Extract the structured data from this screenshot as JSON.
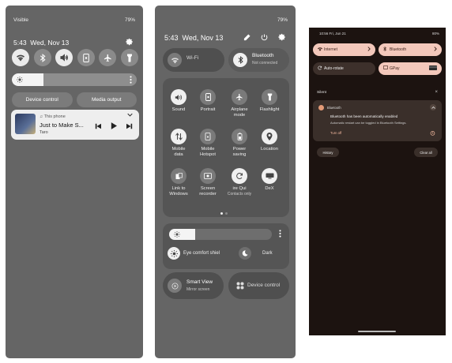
{
  "panel_a": {
    "status": {
      "left": "Visible",
      "right": "79%"
    },
    "clock": {
      "time": "5:43",
      "date": "Wed, Nov 13"
    },
    "toggles": [
      {
        "name": "wifi",
        "icon": "wifi-icon",
        "on": true
      },
      {
        "name": "bluetooth",
        "icon": "bluetooth-icon",
        "on": false
      },
      {
        "name": "sound",
        "icon": "sound-icon",
        "on": true
      },
      {
        "name": "portrait",
        "icon": "portrait-lock-icon",
        "on": false
      },
      {
        "name": "airplane",
        "icon": "airplane-icon",
        "on": false
      },
      {
        "name": "flashlight",
        "icon": "flashlight-icon",
        "on": false
      }
    ],
    "brightness": 0.25,
    "buttons": {
      "device_control": "Device control",
      "media_output": "Media output"
    },
    "media": {
      "source": "This phone",
      "title": "Just to Make S...",
      "artist": "Taro"
    }
  },
  "panel_b": {
    "status": {
      "right": "79%"
    },
    "clock": {
      "time": "5:43",
      "date": "Wed, Nov 13"
    },
    "wifi_tile": {
      "label": "Wi-Fi"
    },
    "bluetooth_tile": {
      "label": "Bluetooth",
      "sub": "Not connected"
    },
    "grid": [
      {
        "label": "Sound",
        "icon": "sound-icon",
        "on": true
      },
      {
        "label": "Portrait",
        "icon": "portrait-lock-icon",
        "on": false
      },
      {
        "label": "Airplane",
        "label2": "mode",
        "icon": "airplane-icon",
        "on": false
      },
      {
        "label": "Flashlight",
        "icon": "flashlight-icon",
        "on": false
      },
      {
        "label": "Mobile",
        "label2": "data",
        "icon": "mobile-data-icon",
        "on": true
      },
      {
        "label": "Mobile",
        "label2": "Hotspot",
        "icon": "hotspot-icon",
        "on": false
      },
      {
        "label": "Power",
        "label2": "saving",
        "icon": "battery-icon",
        "on": false
      },
      {
        "label": "Location",
        "icon": "location-icon",
        "on": true
      },
      {
        "label": "Link to",
        "label2": "Windows",
        "icon": "windows-link-icon",
        "on": false
      },
      {
        "label": "Screen",
        "label2": "recorder",
        "icon": "screen-recorder-icon",
        "on": false
      },
      {
        "label": "ire  Qui",
        "sub": "Contacts only",
        "icon": "quick-share-icon",
        "on": true
      },
      {
        "label": "DeX",
        "icon": "dex-icon",
        "on": true
      }
    ],
    "brightness": 0.25,
    "eye_comfort": "Eye comfort shiel",
    "dark_mode": "Dark",
    "smart_view": {
      "label": "Smart View",
      "sub": "Mirror screen"
    },
    "device_control": "Device control"
  },
  "panel_c": {
    "status": {
      "left": "10:56  Fri, Jun 21",
      "right": "80%"
    },
    "tiles": {
      "internet": "Internet",
      "bluetooth": "Bluetooth",
      "auto_rotate": "Auto-rotate",
      "gpay": "GPay"
    },
    "section": "Silent",
    "notification": {
      "app": "Bluetooth",
      "title": "Bluetooth has been automatically enabled",
      "text": "Automatic restart can be toggled in Bluetooth Settings.",
      "action": "Turn off"
    },
    "buttons": {
      "history": "History",
      "clear_all": "Clear all"
    }
  },
  "colors": {
    "panel_bg": "#656565",
    "accent_pink": "#f3c8bb",
    "dark_bg": "#1c1310"
  }
}
